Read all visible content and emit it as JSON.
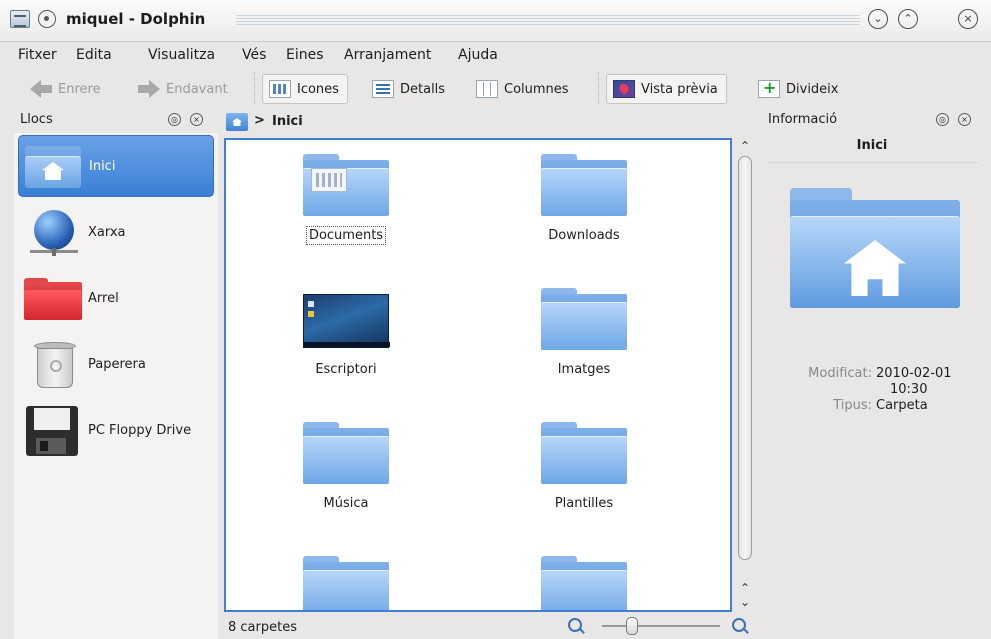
{
  "window": {
    "title": "miquel - Dolphin"
  },
  "menubar": [
    {
      "label": "Fitxer"
    },
    {
      "label": "Edita"
    },
    {
      "label": "Visualitza"
    },
    {
      "label": "Vés"
    },
    {
      "label": "Eines"
    },
    {
      "label": "Arranjament"
    },
    {
      "label": "Ajuda"
    }
  ],
  "toolbar": {
    "back": "Enrere",
    "forward": "Endavant",
    "icons": "Icones",
    "details": "Detalls",
    "columns": "Columnes",
    "preview": "Vista prèvia",
    "split": "Divideix"
  },
  "places": {
    "title": "Llocs",
    "items": [
      {
        "label": "Inici",
        "icon": "home-folder-icon",
        "selected": true
      },
      {
        "label": "Xarxa",
        "icon": "network-globe-icon"
      },
      {
        "label": "Arrel",
        "icon": "red-folder-icon"
      },
      {
        "label": "Paperera",
        "icon": "trash-icon"
      },
      {
        "label": "PC Floppy Drive",
        "icon": "floppy-icon"
      }
    ]
  },
  "breadcrumb": {
    "current": "Inici"
  },
  "files": [
    {
      "label": "Documents"
    },
    {
      "label": "Downloads"
    },
    {
      "label": "Escriptori"
    },
    {
      "label": "Imatges"
    },
    {
      "label": "Música"
    },
    {
      "label": "Plantilles"
    },
    {
      "label": ""
    },
    {
      "label": ""
    }
  ],
  "status": {
    "text": "8 carpetes",
    "zoom": 0.25
  },
  "info": {
    "panel_title": "Informació",
    "name": "Inici",
    "modified_label": "Modificat:",
    "modified_date": "2010-02-01",
    "modified_time": "10:30",
    "type_label": "Tipus:",
    "type_value": "Carpeta"
  },
  "colors": {
    "accent": "#3f7fd5",
    "selection": "#4a8be0"
  }
}
